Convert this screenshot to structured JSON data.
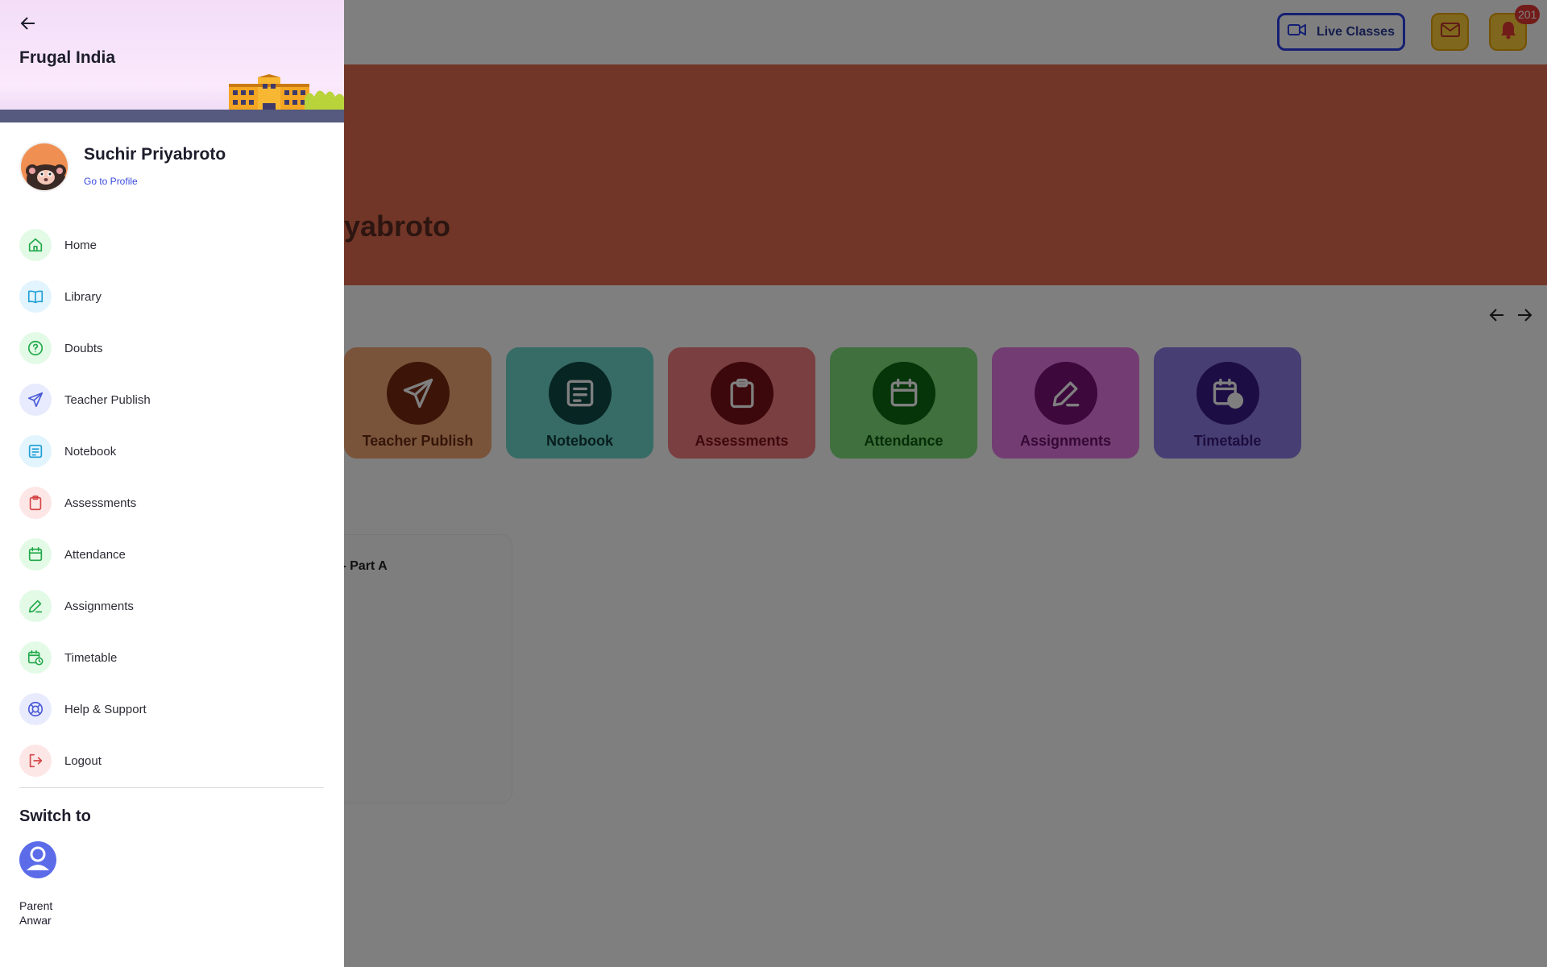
{
  "topbar": {
    "live_classes_label": "Live Classes",
    "notification_count": "201"
  },
  "hero": {
    "greeting_visible": "iyabroto"
  },
  "quick_links": [
    {
      "label": "Teacher Publish",
      "bg": "#f5a874",
      "circle": "#7a2a10",
      "text": "#6a2a12"
    },
    {
      "label": "Notebook",
      "bg": "#6fd8cd",
      "circle": "#0f4a46",
      "text": "#0f3a3a"
    },
    {
      "label": "Assessments",
      "bg": "#f57e83",
      "circle": "#7a1016",
      "text": "#7a1016"
    },
    {
      "label": "Attendance",
      "bg": "#7ee07a",
      "circle": "#0b6a10",
      "text": "#0b5a10"
    },
    {
      "label": "Assignments",
      "bg": "#e67ae6",
      "circle": "#7a127a",
      "text": "#6a106a"
    },
    {
      "label": "Timetable",
      "bg": "#8f7ce9",
      "circle": "#3a1a8a",
      "text": "#3a1a7a"
    }
  ],
  "content_card": {
    "title_visible": "k - Part A"
  },
  "drawer": {
    "org_name": "Frugal India",
    "profile": {
      "name": "Suchir Priyabroto",
      "link": "Go to Profile"
    },
    "menu": [
      {
        "label": "Home",
        "icon": "home-icon",
        "bg": "#e3fbe6",
        "color": "#22a84a"
      },
      {
        "label": "Library",
        "icon": "book-icon",
        "bg": "#e2f4fd",
        "color": "#1e9fd6"
      },
      {
        "label": "Doubts",
        "icon": "question-circle-icon",
        "bg": "#e3fbe6",
        "color": "#22a84a"
      },
      {
        "label": "Teacher Publish",
        "icon": "send-icon",
        "bg": "#e8ebfd",
        "color": "#4a5ad6"
      },
      {
        "label": "Notebook",
        "icon": "note-icon",
        "bg": "#e2f4fd",
        "color": "#1e9fd6"
      },
      {
        "label": "Assessments",
        "icon": "clipboard-icon",
        "bg": "#fde6e6",
        "color": "#d64545"
      },
      {
        "label": "Attendance",
        "icon": "calendar-icon",
        "bg": "#e3fbe6",
        "color": "#22a84a"
      },
      {
        "label": "Assignments",
        "icon": "pencil-icon",
        "bg": "#e3fbe6",
        "color": "#22a84a"
      },
      {
        "label": "Timetable",
        "icon": "calendar-clock-icon",
        "bg": "#e3fbe6",
        "color": "#22a84a"
      },
      {
        "label": "Help & Support",
        "icon": "lifebuoy-icon",
        "bg": "#e8ebfd",
        "color": "#4a5ad6"
      },
      {
        "label": "Logout",
        "icon": "logout-icon",
        "bg": "#fde6e6",
        "color": "#d64545"
      }
    ],
    "switch_to": {
      "title": "Switch to",
      "role": "Parent",
      "name": "Anwar"
    }
  }
}
